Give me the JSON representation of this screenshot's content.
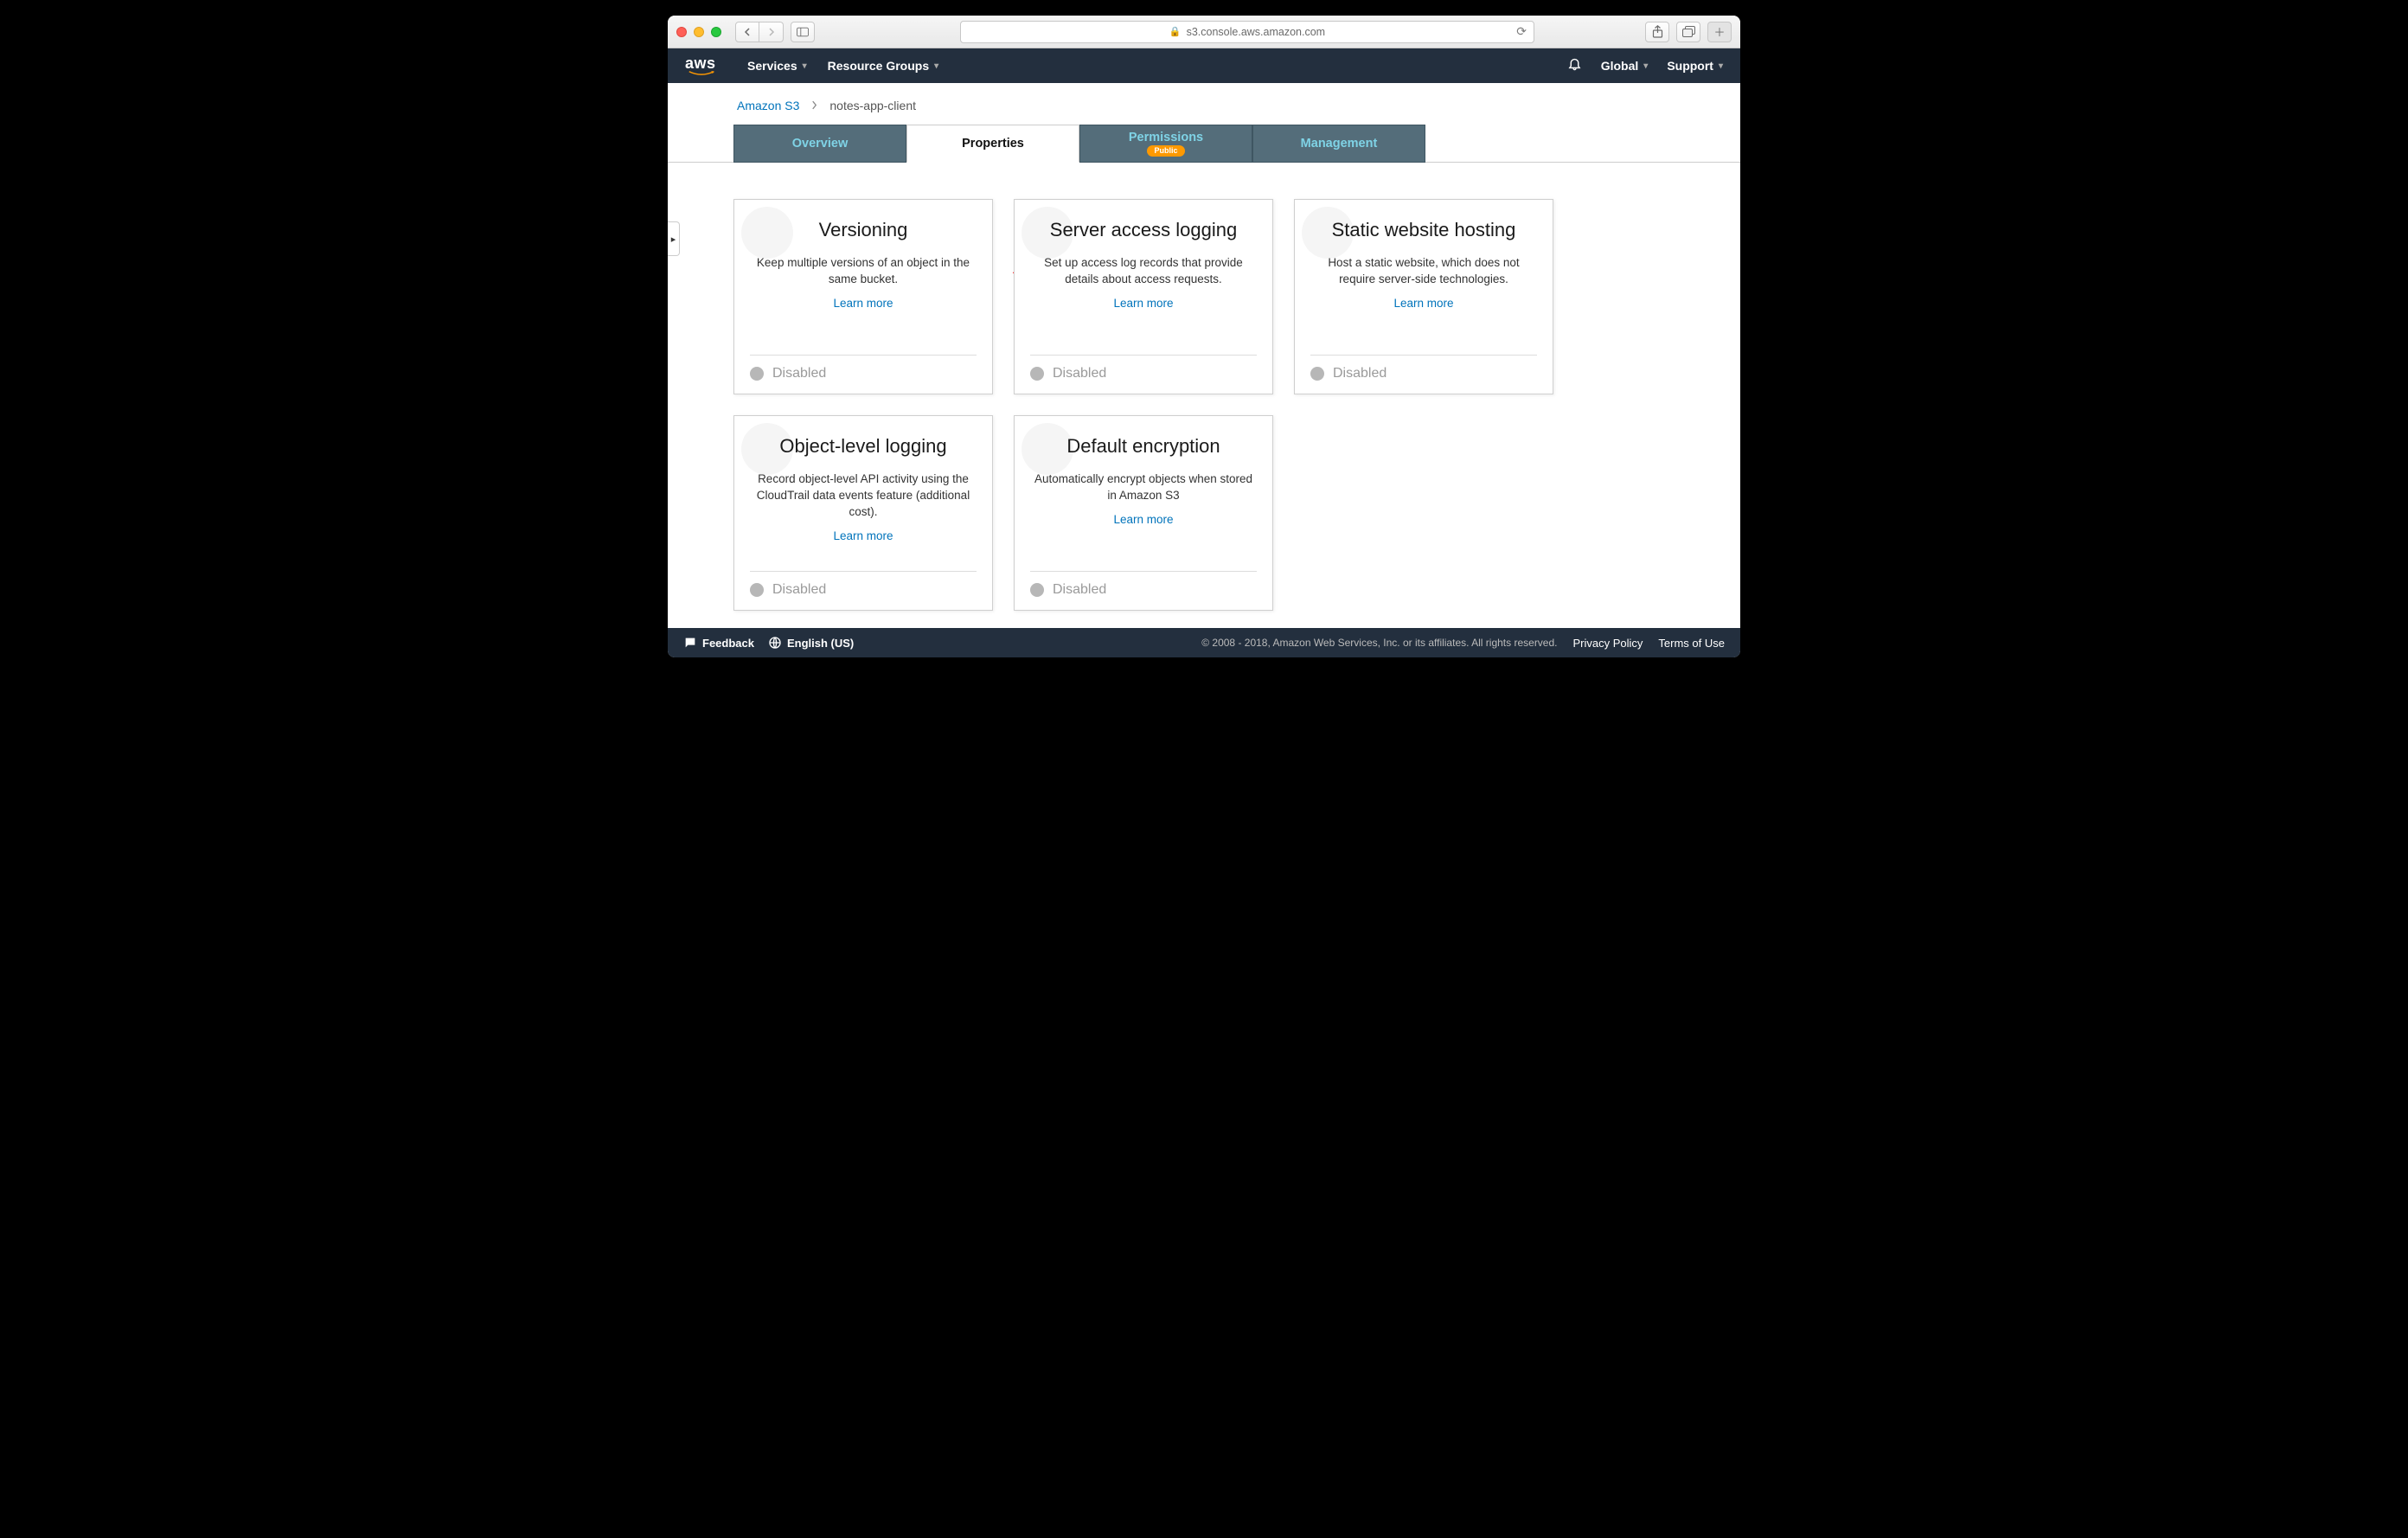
{
  "browser": {
    "url_display": "s3.console.aws.amazon.com"
  },
  "aws_header": {
    "logo_text": "aws",
    "nav": {
      "services": "Services",
      "resource_groups": "Resource Groups"
    },
    "right": {
      "region": "Global",
      "support": "Support"
    }
  },
  "breadcrumb": {
    "root": "Amazon S3",
    "bucket": "notes-app-client"
  },
  "tabs": [
    {
      "label": "Overview",
      "active": false,
      "badge": null
    },
    {
      "label": "Properties",
      "active": true,
      "badge": null
    },
    {
      "label": "Permissions",
      "active": false,
      "badge": "Public"
    },
    {
      "label": "Management",
      "active": false,
      "badge": null
    }
  ],
  "cards": [
    {
      "title": "Versioning",
      "desc": "Keep multiple versions of an object in the same bucket.",
      "learn": "Learn more",
      "status": "Disabled"
    },
    {
      "title": "Server access logging",
      "desc": "Set up access log records that provide details about access requests.",
      "learn": "Learn more",
      "status": "Disabled"
    },
    {
      "title": "Static website hosting",
      "desc": "Host a static website, which does not require server-side technologies.",
      "learn": "Learn more",
      "status": "Disabled"
    },
    {
      "title": "Object-level logging",
      "desc": "Record object-level API activity using the CloudTrail data events feature (additional cost).",
      "learn": "Learn more",
      "status": "Disabled"
    },
    {
      "title": "Default encryption",
      "desc": "Automatically encrypt objects when stored in Amazon S3",
      "learn": "Learn more",
      "status": "Disabled"
    }
  ],
  "footer": {
    "feedback": "Feedback",
    "language": "English (US)",
    "copyright": "© 2008 - 2018, Amazon Web Services, Inc. or its affiliates. All rights reserved.",
    "privacy": "Privacy Policy",
    "terms": "Terms of Use"
  }
}
